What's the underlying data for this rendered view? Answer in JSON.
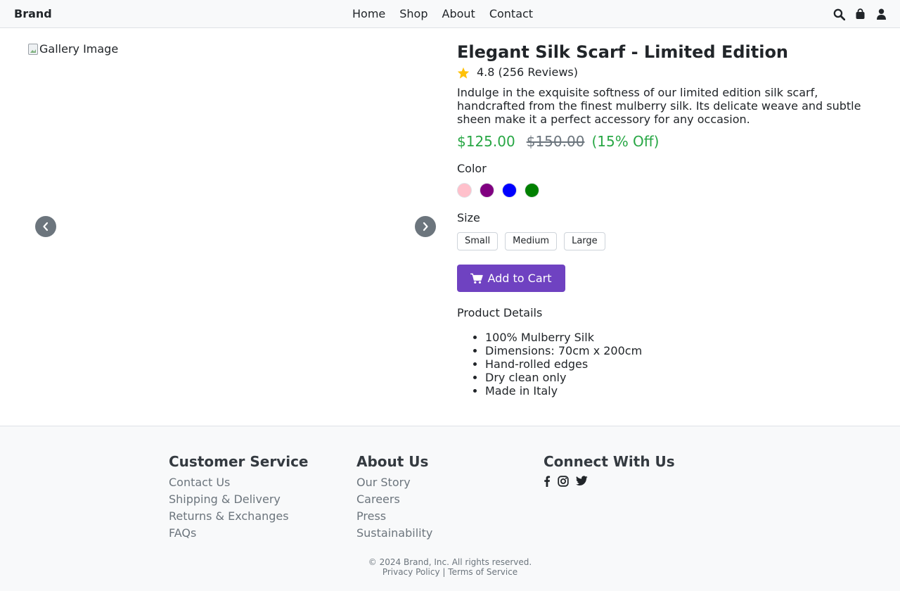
{
  "nav": {
    "brand": "Brand",
    "links": [
      "Home",
      "Shop",
      "About",
      "Contact"
    ],
    "icons": [
      "search-icon",
      "shopping-bag-icon",
      "user-icon"
    ]
  },
  "gallery": {
    "image_alt": "Gallery Image",
    "prev_icon": "chevron-left-icon",
    "next_icon": "chevron-right-icon"
  },
  "product": {
    "title": "Elegant Silk Scarf - Limited Edition",
    "rating": "4.8",
    "reviews": "(256 Reviews)",
    "description": "Indulge in the exquisite softness of our limited edition silk scarf, handcrafted from the finest mulberry silk. Its delicate weave and subtle sheen make it a perfect accessory for any occasion.",
    "price": "$125.00",
    "old_price": "$150.00",
    "discount": "(15% Off)",
    "color_label": "Color",
    "colors": [
      "#ffc0cb",
      "#800080",
      "#0000ff",
      "#008000"
    ],
    "size_label": "Size",
    "sizes": [
      "Small",
      "Medium",
      "Large"
    ],
    "add_to_cart": "Add to Cart",
    "details_label": "Product Details",
    "details": [
      "100% Mulberry Silk",
      "Dimensions: 70cm x 200cm",
      "Hand-rolled edges",
      "Dry clean only",
      "Made in Italy"
    ]
  },
  "footer": {
    "customer_service": {
      "title": "Customer Service",
      "links": [
        "Contact Us",
        "Shipping & Delivery",
        "Returns & Exchanges",
        "FAQs"
      ]
    },
    "about": {
      "title": "About Us",
      "links": [
        "Our Story",
        "Careers",
        "Press",
        "Sustainability"
      ]
    },
    "connect": {
      "title": "Connect With Us",
      "icons": [
        "facebook-icon",
        "instagram-icon",
        "twitter-icon"
      ]
    },
    "copyright": "© 2024 Brand, Inc. All rights reserved.",
    "privacy": "Privacy Policy",
    "separator": "|",
    "terms": "Terms of Service"
  },
  "colors": {
    "accent": "#6f42c1",
    "price": "#28a745",
    "star": "#ffc107"
  }
}
